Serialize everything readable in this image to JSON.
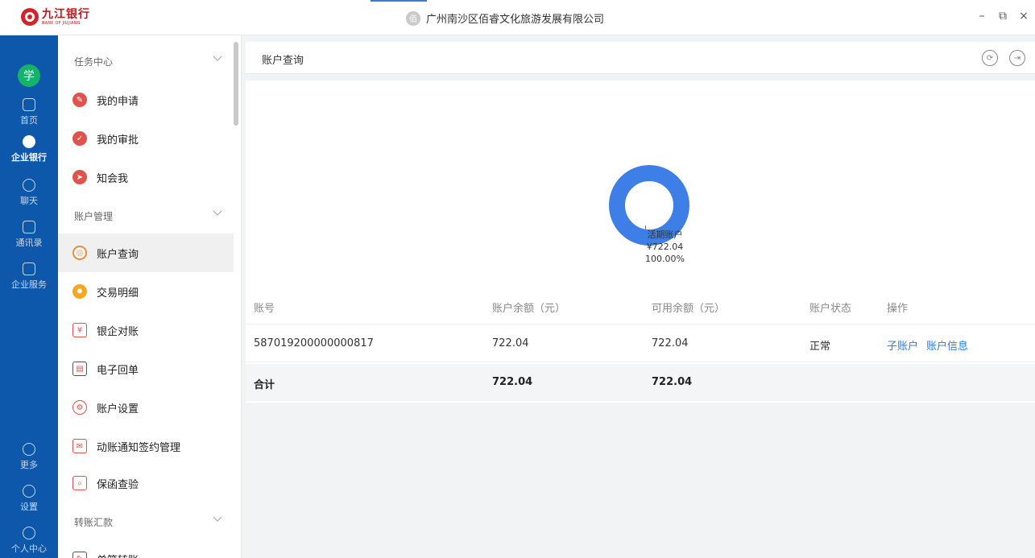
{
  "app": {
    "logo_cn": "九江银行",
    "logo_en": "BANK OF JIUJIANG",
    "company_icon": "佰",
    "company_name": "广州南沙区佰睿文化旅游发展有限公司",
    "window_controls": {
      "minimize": "–",
      "restore": "⧉",
      "close": "×"
    }
  },
  "rail": {
    "avatar": "学",
    "items": [
      {
        "label": "首页",
        "icon": "home-icon"
      },
      {
        "label": "企业银行",
        "icon": "bank-icon",
        "active": true
      },
      {
        "label": "聊天",
        "icon": "chat-icon"
      },
      {
        "label": "通讯录",
        "icon": "contacts-icon"
      },
      {
        "label": "企业服务",
        "icon": "briefcase-icon"
      },
      {
        "label": "更多",
        "icon": "more-icon"
      },
      {
        "label": "设置",
        "icon": "settings-icon"
      },
      {
        "label": "个人中心",
        "icon": "user-icon"
      }
    ]
  },
  "menu": {
    "groups": [
      {
        "label": "任务中心"
      },
      {
        "label": "账户管理"
      },
      {
        "label": "转账汇款"
      }
    ],
    "items": [
      {
        "label": "我的申请",
        "glyph": "✎"
      },
      {
        "label": "我的审批",
        "glyph": "✓"
      },
      {
        "label": "知会我",
        "glyph": "➤"
      },
      {
        "label": "账户查询",
        "glyph": "◎",
        "active": true
      },
      {
        "label": "交易明细",
        "glyph": "✹"
      },
      {
        "label": "银企对账",
        "glyph": "¥"
      },
      {
        "label": "电子回单",
        "glyph": "▤"
      },
      {
        "label": "账户设置",
        "glyph": "⚙"
      },
      {
        "label": "动账通知签约管理",
        "glyph": "✉"
      },
      {
        "label": "保函查验",
        "glyph": "⌕"
      },
      {
        "label": "单笔转账",
        "glyph": "✎"
      }
    ]
  },
  "main": {
    "title": "账户查询",
    "head_icons": {
      "refresh": "⟳",
      "exit": "⇥"
    },
    "chart_data": {
      "type": "pie",
      "categories": [
        "活期账户"
      ],
      "values": [
        722.04
      ],
      "labels": [
        {
          "name": "活期账户",
          "amount": "¥722.04",
          "percent": "100.00%"
        }
      ],
      "colors": [
        "#3d7fe6"
      ]
    },
    "table": {
      "headers": [
        "账号",
        "账户余额（元）",
        "可用余额（元）",
        "账户状态",
        "操作"
      ],
      "rows": [
        {
          "account": "587019200000000817",
          "balance": "722.04",
          "available": "722.04",
          "status": "正常",
          "actions": [
            "子账户",
            "账户信息"
          ]
        }
      ],
      "total": {
        "label": "合计",
        "balance": "722.04",
        "available": "722.04"
      }
    }
  }
}
